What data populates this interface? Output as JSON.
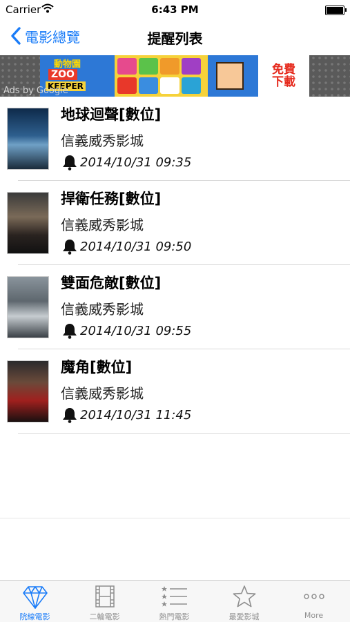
{
  "status_bar": {
    "carrier": "Carrier",
    "time": "6:43 PM"
  },
  "nav": {
    "back_label": "電影總覽",
    "title": "提醒列表"
  },
  "ad": {
    "label": "Ads by Google",
    "brand_top": "動物園",
    "brand_zoo": "ZOO",
    "brand_keeper": "KEEPER",
    "badge": "免費下載"
  },
  "reminders": [
    {
      "title": "地球迴聲[數位]",
      "theater": "信義威秀影城",
      "showtime": "2014/10/31 09:35"
    },
    {
      "title": "捍衛任務[數位]",
      "theater": "信義威秀影城",
      "showtime": "2014/10/31 09:50"
    },
    {
      "title": "雙面危敵[數位]",
      "theater": "信義威秀影城",
      "showtime": "2014/10/31 09:55"
    },
    {
      "title": "魔角[數位]",
      "theater": "信義威秀影城",
      "showtime": "2014/10/31 11:45"
    }
  ],
  "tabs": [
    {
      "label": "院線電影",
      "icon": "diamond-icon",
      "active": true
    },
    {
      "label": "二輪電影",
      "icon": "film-icon",
      "active": false
    },
    {
      "label": "熱門電影",
      "icon": "ranked-list-icon",
      "active": false
    },
    {
      "label": "最愛影城",
      "icon": "star-icon",
      "active": false
    },
    {
      "label": "More",
      "icon": "more-dots-icon",
      "active": false
    }
  ],
  "colors": {
    "accent": "#1a7cf8",
    "tab_inactive": "#8e8e8e",
    "separator": "#d9d9d9"
  }
}
